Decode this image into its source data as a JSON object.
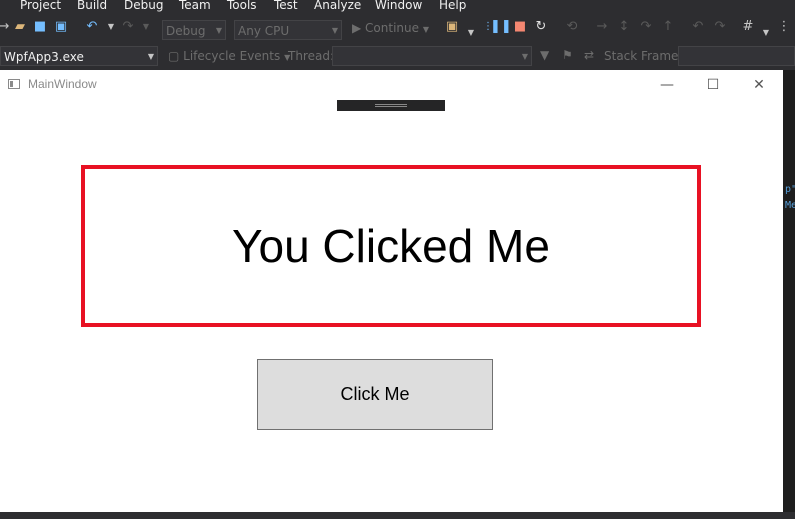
{
  "menu": [
    "Project",
    "Build",
    "Debug",
    "Team",
    "Tools",
    "Test",
    "Analyze",
    "Window",
    "Help"
  ],
  "toolbar": {
    "config": "Debug",
    "platform": "Any CPU",
    "continue_label": "Continue"
  },
  "toolbar2": {
    "process": "WpfApp3.exe",
    "lifecycle": "Lifecycle Events",
    "thread_label": "Thread:",
    "stack_frame_label": "Stack Frame:"
  },
  "window": {
    "title": "MainWindow",
    "minimize": "—",
    "maximize": "☐",
    "close": "✕"
  },
  "content": {
    "textbox_text": "You Clicked Me",
    "button_label": "Click Me"
  },
  "code_fragments": [
    "p\"",
    "Me"
  ],
  "colors": {
    "ide_bg": "#2d2d30",
    "highlight_border": "#e81123",
    "button_bg": "#dddddd"
  }
}
